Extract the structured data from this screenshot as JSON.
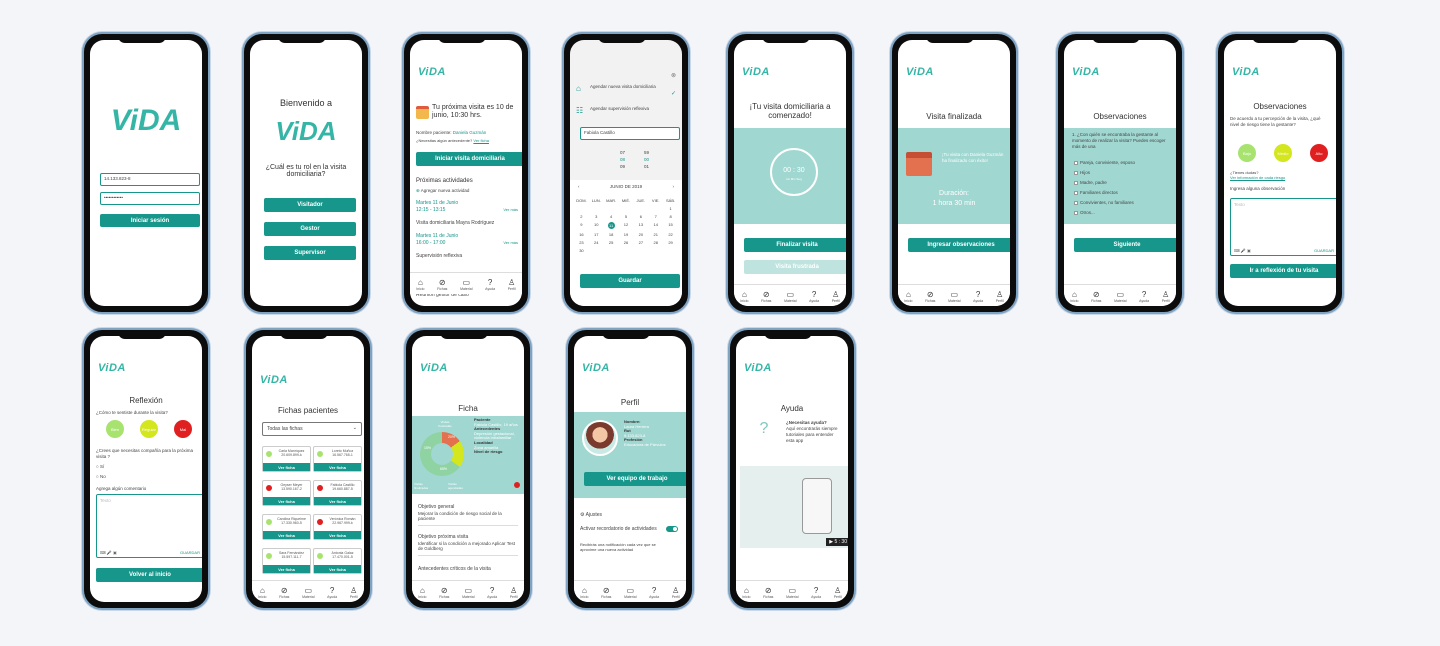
{
  "brand": {
    "logo": "ViDA",
    "accent": "#17968b",
    "light_teal": "#a0d7d1"
  },
  "nav": [
    "Inicio",
    "Fichas",
    "Material",
    "Ayuda",
    "Perfil"
  ],
  "login": {
    "rut": "14.133.823-8",
    "password": "••••••••••••",
    "button": "Iniciar sesión"
  },
  "role": {
    "welcome": "Bienvenido a",
    "question": "¿Cuál es tu rol en la visita domiciliaria?",
    "buttons": [
      "Visitador",
      "Gestor",
      "Supervisor"
    ]
  },
  "home": {
    "next_visit": "Tu próxima visita es 10 de junio, 10:30 hrs.",
    "patient_label": "Nombre paciente:",
    "patient": "Daniela Guzmán",
    "antecedent": "¿Necesitas algún antecedente?",
    "see_file": "Ver ficha",
    "start_btn": "Iniciar visita domiciliaria",
    "upcoming": "Próximas actividades",
    "add": "Agregar nueva actividad",
    "activities": [
      {
        "date": "Martes 11 de Junio",
        "time": "12:15 - 13:15",
        "more": "Ver más",
        "desc": "Visita domiciliaria Mayra Rodríguez"
      },
      {
        "date": "Martes 11 de Junio",
        "time": "16:00 - 17:00",
        "more": "Ver más",
        "desc": "Supervisión reflexiva"
      }
    ],
    "extra": "Reunión gestor de caso"
  },
  "schedule": {
    "opt1": "Agendar nueva visita domiciliaria",
    "opt2": "Agendar supervisión reflexiva",
    "name": "Fabiola Castillo",
    "hours": [
      "07",
      "08",
      "09"
    ],
    "mins": [
      "59",
      "00",
      "01"
    ],
    "month": "JUNIO DE 2019",
    "days": [
      "DOM.",
      "LUN.",
      "MAR.",
      "MIÉ.",
      "JUE.",
      "VIE.",
      "SÁB."
    ],
    "dates": [
      "",
      "",
      "",
      "",
      "",
      "",
      "1",
      "2",
      "3",
      "4",
      "5",
      "6",
      "7",
      "8",
      "9",
      "10",
      "11",
      "12",
      "13",
      "14",
      "15",
      "16",
      "17",
      "18",
      "19",
      "20",
      "21",
      "22",
      "23",
      "24",
      "25",
      "26",
      "27",
      "28",
      "29",
      "30",
      "",
      "",
      "",
      "",
      "",
      ""
    ],
    "save": "Guardar"
  },
  "started": {
    "title": "¡Tu visita domiciliaria a comenzado!",
    "timer": "00 : 30",
    "units": "Hs  Min  Seg",
    "end": "Finalizar visita",
    "frustrated": "Visita frustrada"
  },
  "finished": {
    "title": "Visita finalizada",
    "msg": "¡Tu visita con Daniela Guzmán ha finalizado con éxito!",
    "dur_label": "Duración:",
    "dur": "1 hora 30 min",
    "btn": "Ingresar observaciones"
  },
  "obs1": {
    "title": "Observaciones",
    "q": "1. ¿Con quién se encontraba la gestante al momento de realizar la visita? Puedes escoger más de una",
    "opts": [
      "Pareja, conviviente, esposo",
      "Hijos",
      "Madre, padre",
      "Familiares directos",
      "Convivientes, no familiares",
      "Otros..."
    ],
    "next": "Siguiente"
  },
  "obs2": {
    "title": "Observaciones",
    "q": "De acuerdo a tu percepción de la visita, ¿qué nivel de riesgo tiene la gestante?",
    "levels": [
      "Bajo",
      "Medio",
      "Alto"
    ],
    "doubts": "¿Tienes dudas?",
    "info": "Ver información de cada riesgo",
    "prompt": "Ingresa alguna observación",
    "placeholder": "Texto",
    "save": "GUARDAR",
    "btn": "Ir a reflexión de tu visita"
  },
  "reflect": {
    "title": "Reflexión",
    "q1": "¿Cómo te sentiste durante la visita?",
    "levels": [
      "Bien",
      "Regular",
      "Mal"
    ],
    "q2": "¿Crees que necesitas compañía para la próxima visita ?",
    "yes": "Sí",
    "no": "No",
    "prompt": "Agrega algún comentario",
    "placeholder": "Texto",
    "save": "GUARDAR",
    "btn": "Volver al inicio"
  },
  "files": {
    "title": "Fichas pacientes",
    "filter": "Todas las fichas",
    "btn": "Ver ficha",
    "patients": [
      {
        "name": "Carla Manríquez",
        "rut": "20.609.899-k",
        "color": "#a8e36f"
      },
      {
        "name": "Loreto Muñoz",
        "rut": "16.567.765-1",
        "color": "#a8e36f"
      },
      {
        "name": "Geyser Meyer",
        "rut": "13.590.167-2",
        "color": "#e02020"
      },
      {
        "name": "Fabiola Castillo",
        "rut": "19.660.887-5",
        "color": "#e02020"
      },
      {
        "name": "Carolina Riquelme",
        "rut": "17.330.960-5",
        "color": "#a8e36f"
      },
      {
        "name": "Verónica Román",
        "rut": "22.967.999-k",
        "color": "#e02020"
      },
      {
        "name": "Sara Fernández",
        "rut": "15.597.111-7",
        "color": "#a8e36f"
      },
      {
        "name": "Antonia Galaz",
        "rut": "17.470.001-5",
        "color": "#a8e36f"
      }
    ]
  },
  "ficha": {
    "title": "Ficha",
    "patient_h": "Paciente",
    "patient": "Fabiola Castillo, 19 años",
    "ante_h": "Antecedentes",
    "ante": "Depresión gestacional, violencia intrafamiliar",
    "loc_h": "Localidad",
    "loc": "Zona amarilla",
    "risk": "Nivel de riesgo",
    "labels": [
      "Visitas finalizadas",
      "Visitas frustradas",
      "Visitas agendadas"
    ],
    "pcts": [
      "15%",
      "20%",
      "65%"
    ],
    "obj_h": "Objetivo general",
    "obj": "Mejorar la condición de riesgo social de la paciente",
    "next_h": "Objetivo próxima visita",
    "next": "Identificar si la condición a mejorado Aplicar Test de Goldberg",
    "crit_h": "Antecedentes críticos de la visita"
  },
  "profile": {
    "title": "Perfil",
    "name_h": "Nombre:",
    "name": "Laura Herrera",
    "rut_h": "Rut",
    "rut": "9.133.823-8",
    "prof_h": "Profesión",
    "prof": "Educadora de Párvulos",
    "team_btn": "Ver equipo de trabajo",
    "settings": "Ajustes",
    "rem_h": "Activar recordatorio de actividades",
    "rem": "Recibirás una notificación cada vez que se aproxime una nueva actividad"
  },
  "help": {
    "title": "Ayuda",
    "q": "¿Necesitas ayuda?",
    "txt": "Aquí encontrarás siempre tutoriales para entender esta app",
    "video_time": "5 : 30"
  }
}
